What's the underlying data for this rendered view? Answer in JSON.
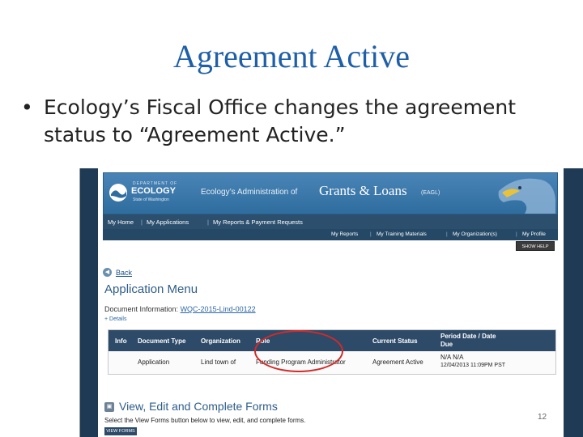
{
  "slide": {
    "title": "Agreement Active",
    "bullet_symbol": "•",
    "bullet_text": "Ecology’s Fiscal Office changes the agreement status to “Agreement Active.”",
    "page_number": "12"
  },
  "banner": {
    "logo_dept": "DEPARTMENT OF",
    "logo_name": "ECOLOGY",
    "logo_state": "State of Washington",
    "admin_text": "Ecology’s Administration of",
    "grants_text": "Grants & Loans",
    "eagl_text": "(EAGL)"
  },
  "nav_primary": [
    "My Home",
    "My Applications",
    "My Reports & Payment Requests"
  ],
  "nav_secondary": [
    "My Reports",
    "My Training Materials",
    "My Organization(s)",
    "My Profile"
  ],
  "help_button": "SHOW HELP",
  "back_label": "Back",
  "page_title": "Application Menu",
  "document_info": {
    "label": "Document Information:",
    "id": "WQC-2015-Lind-00122"
  },
  "details_label": "Details",
  "table": {
    "headers": [
      "Info",
      "Document Type",
      "Organization",
      "Role",
      "Current Status",
      "Period Date / Date Due"
    ],
    "row": {
      "document_type": "Application",
      "organization": "Lind town of",
      "role": "Funding Program Administrator",
      "status": "Agreement Active",
      "period": "N/A   N/A",
      "date_due": "12/04/2013 11:09PM PST"
    }
  },
  "forms_section": {
    "title": "View, Edit and Complete Forms",
    "description": "Select the View Forms button below to view, edit, and complete forms.",
    "button": "VIEW FORMS"
  },
  "colors": {
    "title_blue": "#1f5fa8",
    "header_navy": "#2d4a68",
    "highlight_red": "#d22a2a"
  }
}
